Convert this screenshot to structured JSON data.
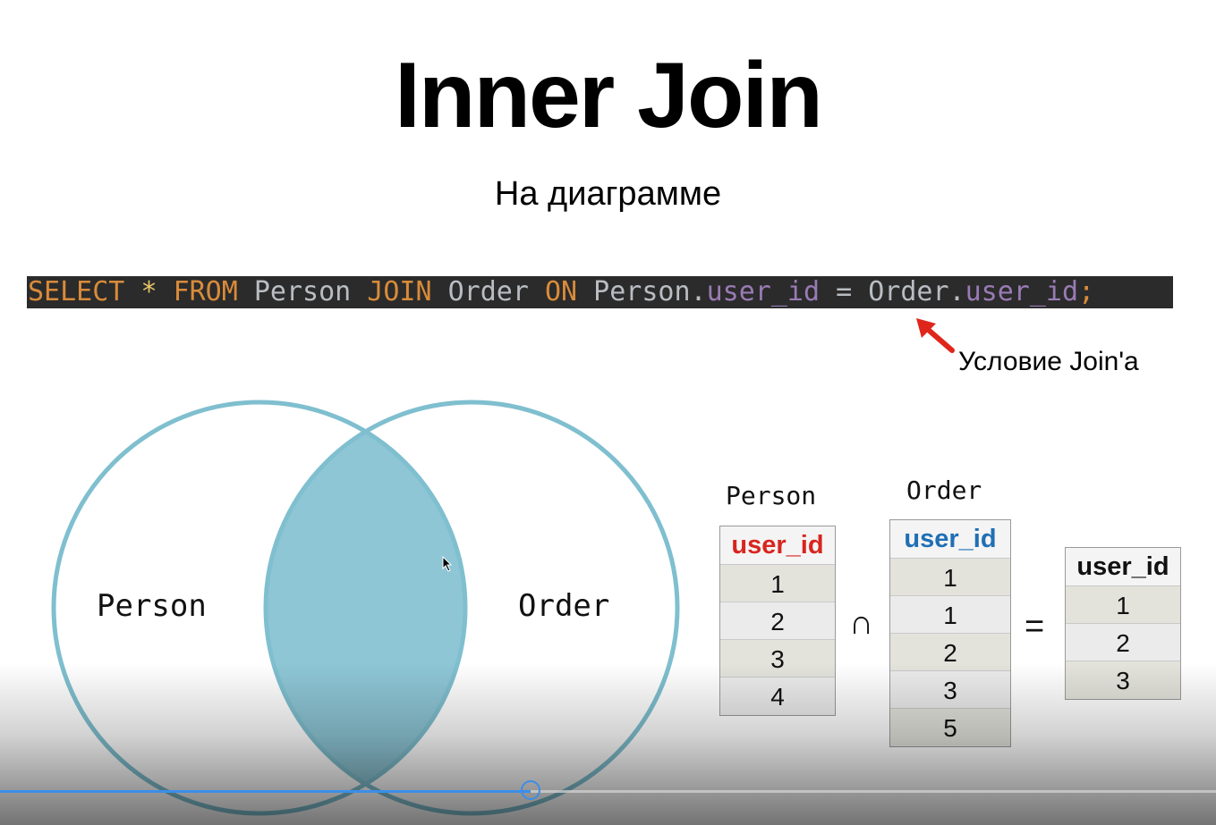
{
  "slide": {
    "title": "Inner Join",
    "subtitle": "На диаграмме"
  },
  "code": {
    "tokens": [
      {
        "text": "SELECT",
        "color": "#d98b3a"
      },
      {
        "text": " ",
        "color": "#b9bdc2"
      },
      {
        "text": "*",
        "color": "#e8c46a"
      },
      {
        "text": " ",
        "color": "#b9bdc2"
      },
      {
        "text": "FROM",
        "color": "#d98b3a"
      },
      {
        "text": " Person ",
        "color": "#b9bdc2"
      },
      {
        "text": "JOIN",
        "color": "#d98b3a"
      },
      {
        "text": " Order ",
        "color": "#b9bdc2"
      },
      {
        "text": "ON",
        "color": "#d98b3a"
      },
      {
        "text": " Person.",
        "color": "#b9bdc2"
      },
      {
        "text": "user_id",
        "color": "#9a7bb5"
      },
      {
        "text": " = Order.",
        "color": "#b9bdc2"
      },
      {
        "text": "user_id",
        "color": "#9a7bb5"
      },
      {
        "text": ";",
        "color": "#d98b3a"
      }
    ]
  },
  "annotation": {
    "label": "Условие Join'a",
    "arrow_color": "#e0261b"
  },
  "venn": {
    "left_label": "Person",
    "right_label": "Order",
    "circle_stroke": "#7fbfcf",
    "intersection_fill": "#8ec6d6"
  },
  "tables": {
    "person": {
      "title": "Person",
      "header": "user_id",
      "header_color": "#d8251e",
      "rows": [
        "1",
        "2",
        "3",
        "4"
      ]
    },
    "order": {
      "title": "Order",
      "header": "user_id",
      "header_color": "#1f6fb5",
      "rows": [
        "1",
        "1",
        "2",
        "3",
        "5"
      ]
    },
    "result": {
      "header": "user_id",
      "header_color": "#111111",
      "rows": [
        "1",
        "2",
        "3"
      ]
    },
    "intersect_symbol": "∩",
    "equals_symbol": "="
  },
  "player": {
    "progress": 0.436,
    "accent": "#3b8ee8"
  }
}
